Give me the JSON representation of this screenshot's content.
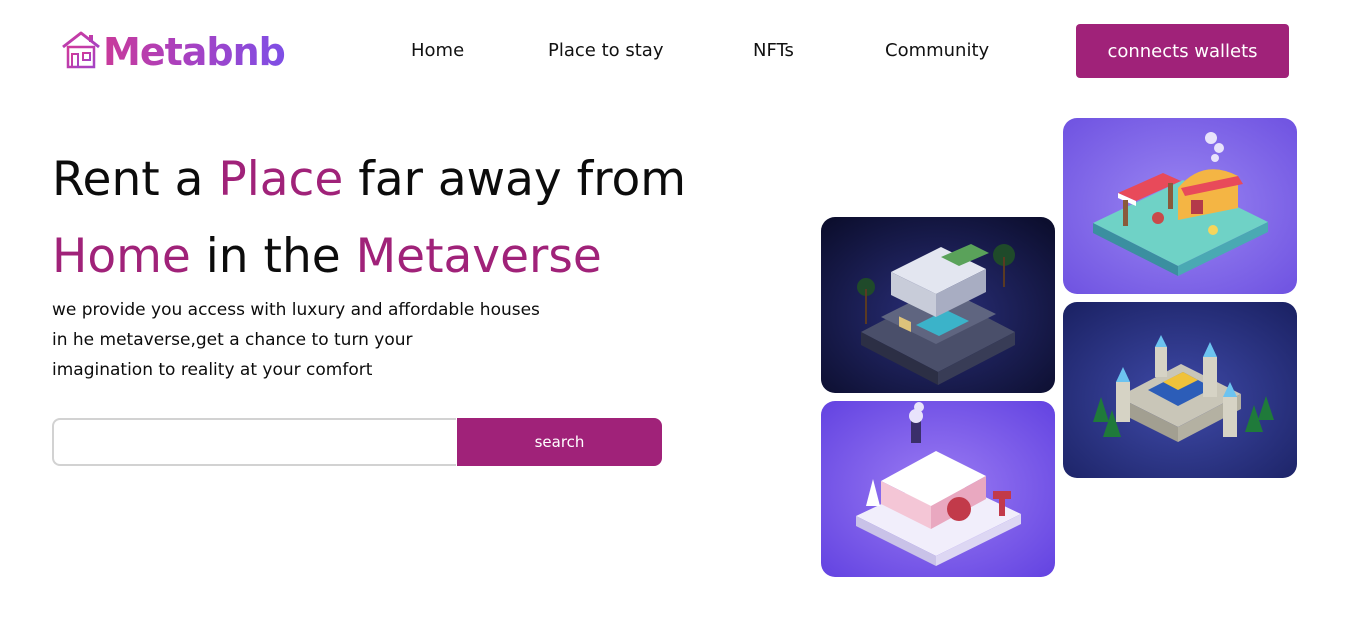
{
  "brand": {
    "name": "Metabnb"
  },
  "nav": {
    "items": [
      "Home",
      "Place to stay",
      "NFTs",
      "Community"
    ]
  },
  "header": {
    "cta_label": "connects wallets"
  },
  "hero": {
    "line1_a": "Rent a ",
    "line1_b": "Place",
    "line1_c": " far away from",
    "line2_a": "Home",
    "line2_b": " in the ",
    "line2_c": "Metaverse",
    "description": [
      "we provide you access with luxury and affordable houses",
      "in he metaverse,get a chance to turn your",
      "imagination to reality at your comfort"
    ],
    "search": {
      "value": "",
      "placeholder": "",
      "button_label": "search"
    }
  },
  "gallery": {
    "images": [
      "modern-villa-pool",
      "market-stall",
      "snowy-cottage",
      "castle-fortress"
    ]
  },
  "colors": {
    "accent": "#a02279",
    "logo_gradient": [
      "#c93a9a",
      "#7e4fe6"
    ],
    "text": "#0c0c0c"
  }
}
